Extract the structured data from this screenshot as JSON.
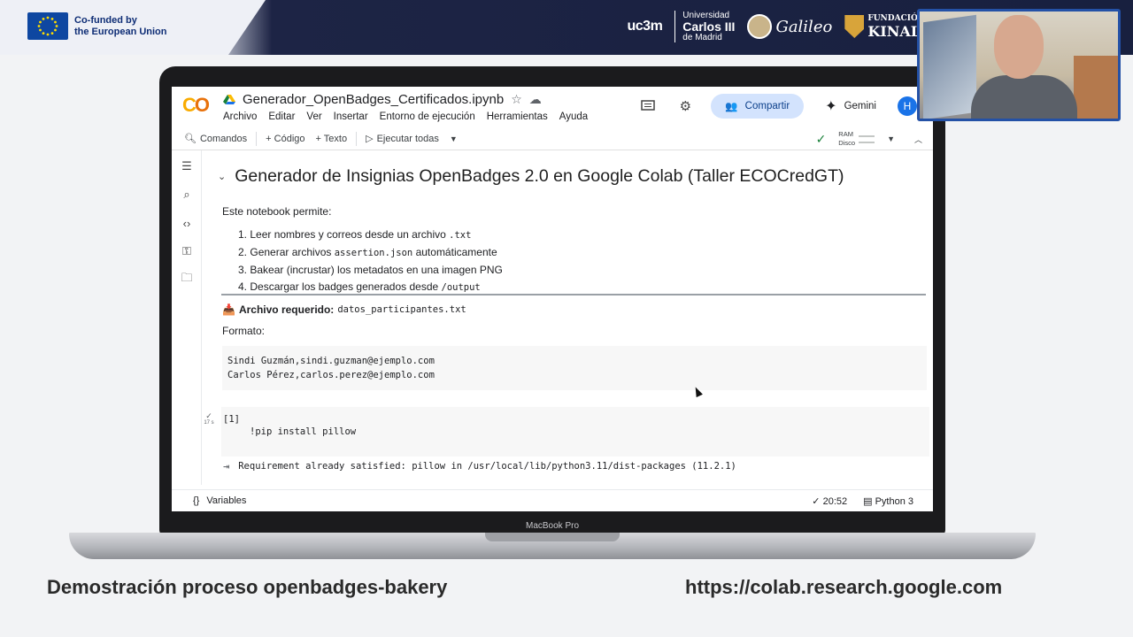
{
  "banner": {
    "eu_text_line1": "Co-funded by",
    "eu_text_line2": "the European Union",
    "uc3m": "uc3m",
    "carlos_line1": "Universidad",
    "carlos_line2": "Carlos III",
    "carlos_line3": "de Madrid",
    "galileo": "Galileo",
    "kinal_line1": "FUNDACIÓ",
    "kinal_line2": "KINAL"
  },
  "colab": {
    "logo": "CO",
    "file_title": "Generador_OpenBadges_Certificados.ipynb",
    "menu": [
      "Archivo",
      "Editar",
      "Ver",
      "Insertar",
      "Entorno de ejecución",
      "Herramientas",
      "Ayuda"
    ],
    "share_label": "Compartir",
    "gemini_label": "Gemini",
    "avatar": "H",
    "toolbar": {
      "commands": "Comandos",
      "code": "+ Código",
      "text": "+ Texto",
      "run_all": "Ejecutar todas",
      "ram": "RAM",
      "disk": "Disco"
    },
    "notebook": {
      "heading": "Generador de Insignias OpenBadges 2.0 en Google Colab (Taller ECOCredGT)",
      "intro": "Este notebook permite:",
      "steps": [
        {
          "num": "1.",
          "text": "Leer nombres y correos desde un archivo ",
          "code": ".txt",
          "after": ""
        },
        {
          "num": "2.",
          "text": "Generar archivos ",
          "code": "assertion.json",
          "after": " automáticamente"
        },
        {
          "num": "3.",
          "text": "Bakear (incrustar) los metadatos en una imagen PNG",
          "code": "",
          "after": ""
        },
        {
          "num": "4.",
          "text": "Descargar los badges generados desde ",
          "code": "/output",
          "after": ""
        }
      ],
      "required_label": "Archivo requerido:",
      "required_file": "datos_participantes.txt",
      "format_label": "Formato:",
      "format_lines": [
        "Sindi Guzmán,sindi.guzman@ejemplo.com",
        "Carlos Pérez,carlos.perez@ejemplo.com"
      ],
      "cell_exec": "[1]",
      "cell_time": "17 s",
      "cell_code": "!pip install pillow",
      "cell_output": "Requirement already satisfied: pillow in /usr/local/lib/python3.11/dist-packages (11.2.1)"
    },
    "status": {
      "variables": "Variables",
      "time": "20:52",
      "runtime": "Python 3"
    }
  },
  "laptop_label": "MacBook Pro",
  "captions": {
    "left": "Demostración proceso openbadges-bakery",
    "right": "https://colab.research.google.com"
  },
  "colors": {
    "banner_dark": "#18203f",
    "share_bg": "#d3e3fd",
    "colab_orange": "#f9ab00",
    "webcam_border": "#2451a6"
  }
}
